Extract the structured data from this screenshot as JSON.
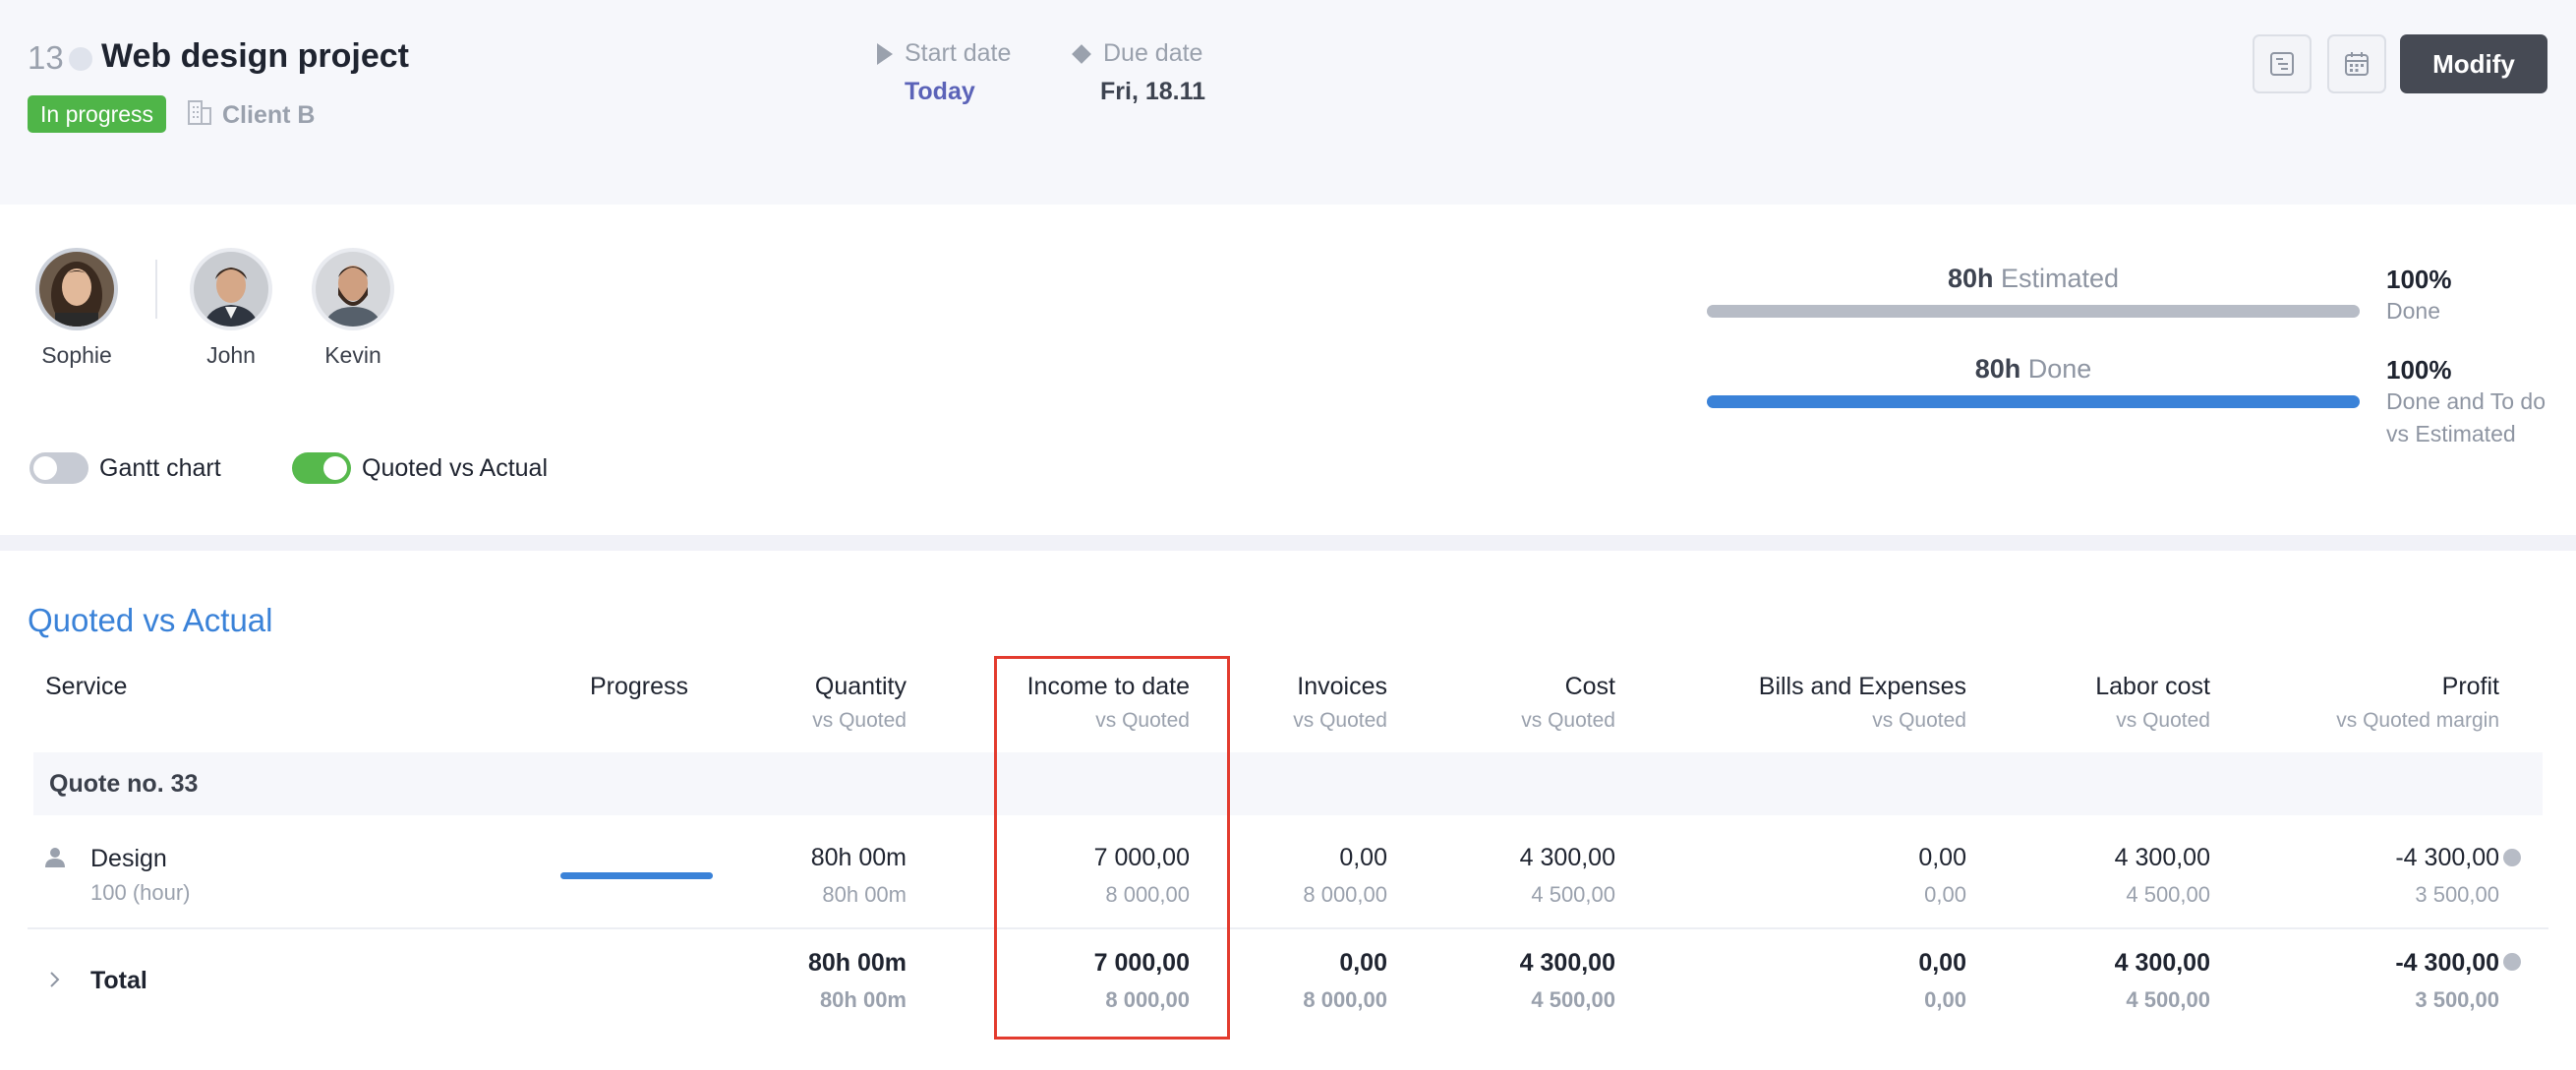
{
  "project": {
    "number": "13",
    "title": "Web design project",
    "status": "In progress",
    "client": "Client B",
    "start_label": "Start date",
    "start_value": "Today",
    "due_label": "Due date",
    "due_value": "Fri, 18.11",
    "modify_label": "Modify"
  },
  "team": [
    {
      "name": "Sophie"
    },
    {
      "name": "John"
    },
    {
      "name": "Kevin"
    }
  ],
  "toggles": {
    "gantt_label": "Gantt chart",
    "gantt_on": false,
    "qva_label": "Quoted vs Actual",
    "qva_on": true
  },
  "summary": {
    "estimated_hours": "80h",
    "estimated_label": "Estimated",
    "estimated_fraction": 1.0,
    "done_hours": "80h",
    "done_label": "Done",
    "done_fraction": 1.0,
    "pct1": "100%",
    "pct1_label": "Done",
    "pct2": "100%",
    "pct2_label_line1": "Done and To do",
    "pct2_label_line2": "vs Estimated"
  },
  "qva": {
    "title": "Quoted vs Actual",
    "headers": {
      "service": "Service",
      "progress": "Progress",
      "quantity": "Quantity",
      "income": "Income to date",
      "invoices": "Invoices",
      "cost": "Cost",
      "bills": "Bills and Expenses",
      "labor": "Labor cost",
      "profit": "Profit",
      "vs_quoted": "vs Quoted",
      "vs_margin": "vs Quoted margin"
    },
    "group": "Quote no. 33",
    "row": {
      "service": "Design",
      "unit": "100 (hour)",
      "progress_fraction": 1.0,
      "quantity": "80h 00m",
      "quantity_q": "80h 00m",
      "income": "7 000,00",
      "income_q": "8 000,00",
      "invoices": "0,00",
      "invoices_q": "8 000,00",
      "cost": "4 300,00",
      "cost_q": "4 500,00",
      "bills": "0,00",
      "bills_q": "0,00",
      "labor": "4 300,00",
      "labor_q": "4 500,00",
      "profit": "-4 300,00",
      "profit_q": "3 500,00"
    },
    "total": {
      "label": "Total",
      "quantity": "80h 00m",
      "quantity_q": "80h 00m",
      "income": "7 000,00",
      "income_q": "8 000,00",
      "invoices": "0,00",
      "invoices_q": "8 000,00",
      "cost": "4 300,00",
      "cost_q": "4 500,00",
      "bills": "0,00",
      "bills_q": "0,00",
      "labor": "4 300,00",
      "labor_q": "4 500,00",
      "profit": "-4 300,00",
      "profit_q": "3 500,00"
    }
  }
}
